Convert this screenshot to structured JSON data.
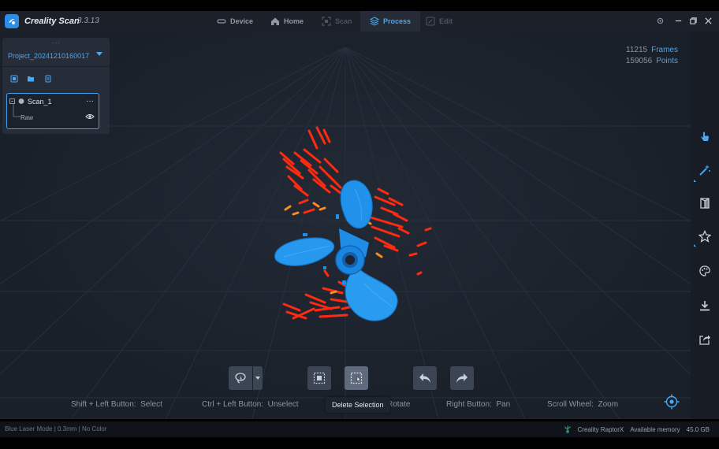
{
  "app": {
    "title": "Creality Scan",
    "version": "3.3.13"
  },
  "nav": [
    {
      "label": "Device",
      "icon": "device-icon",
      "state": "normal"
    },
    {
      "label": "Home",
      "icon": "home-icon",
      "state": "normal"
    },
    {
      "label": "Scan",
      "icon": "scan-icon",
      "state": "disabled"
    },
    {
      "label": "Process",
      "icon": "process-icon",
      "state": "active"
    },
    {
      "label": "Edit",
      "icon": "edit-icon",
      "state": "disabled"
    }
  ],
  "project": {
    "name": "Project_20241210160017",
    "scan": {
      "name": "Scan_1",
      "child": "Raw",
      "more": "···"
    }
  },
  "stats": {
    "frames_value": "11215",
    "frames_label": "Frames",
    "points_value": "159056",
    "points_label": "Points"
  },
  "tooltip": "Delete Selection",
  "hints": {
    "select": "Shift + Left Button:  Select",
    "unselect": "Ctrl + Left Button:  Unselect",
    "rotate": "Rotate",
    "pan": "Right Button:  Pan",
    "zoom": "Scroll Wheel:  Zoom"
  },
  "status": {
    "left": "Blue Laser Mode | 0.3mm | No Color",
    "device": "Creality RaptorX",
    "memory_label": "Available memory",
    "memory_value": "45.0 GB"
  },
  "colors": {
    "accent": "#4aa7f0",
    "model_blue": "#1e8ee8",
    "cloud_red": "#ff2a10",
    "cloud_orange": "#ff8a20"
  }
}
